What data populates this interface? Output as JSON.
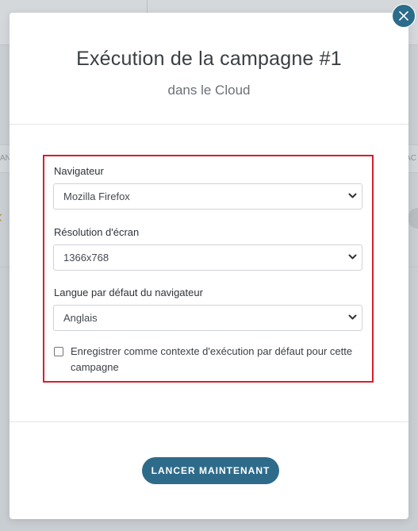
{
  "modal": {
    "title": "Exécution de la campagne #1",
    "subtitle": "dans le Cloud",
    "close_icon": "close-icon"
  },
  "form": {
    "browser": {
      "label": "Navigateur",
      "value": "Mozilla Firefox"
    },
    "resolution": {
      "label": "Résolution d'écran",
      "value": "1366x768"
    },
    "language": {
      "label": "Langue par défaut du navigateur",
      "value": "Anglais"
    },
    "default_context": {
      "label": "Enregistrer comme contexte d'exécution par défaut pour cette campagne",
      "checked": false
    }
  },
  "footer": {
    "launch_label": "LANCER MAINTENANT"
  },
  "background": {
    "left_fragment": "AN",
    "right_fragment": "AC"
  },
  "colors": {
    "accent": "#2e6b8a",
    "highlight_border": "#d81e2c"
  }
}
